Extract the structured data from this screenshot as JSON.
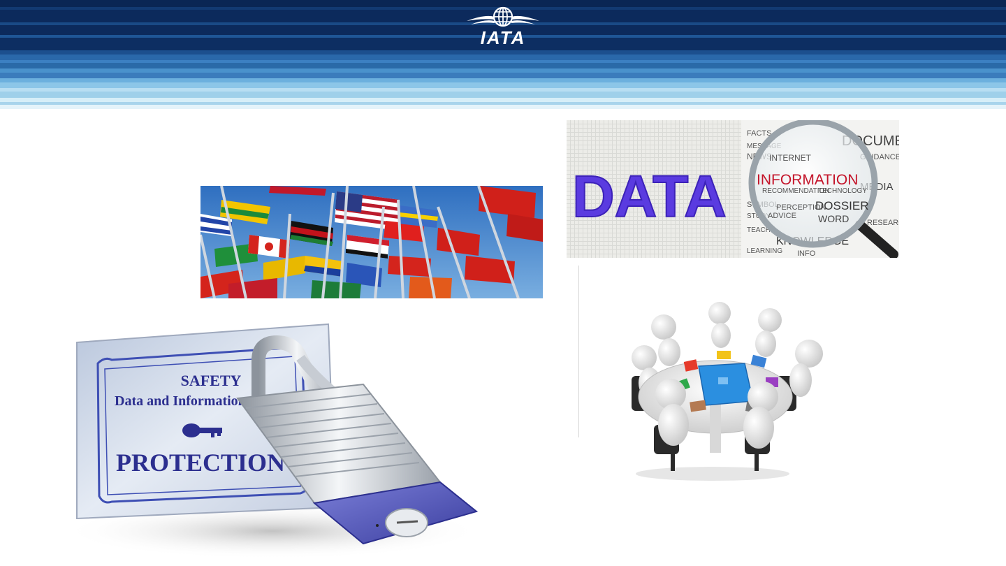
{
  "header": {
    "logo_text": "IATA",
    "colors": {
      "navy": "#0c2a5c",
      "mid_blue": "#2a6aa8",
      "light_blue": "#9fd0ea"
    }
  },
  "images": {
    "flags": {
      "icon": "world-flags-photo"
    },
    "data": {
      "icon": "data-word-cloud-magnifier",
      "title_word": "DATA",
      "magnified_word": "INFORMATION",
      "words": [
        "KNOWLEDGE",
        "DOSSIER",
        "WORD",
        "NEWS",
        "ADVICE",
        "LEARNING",
        "INFO",
        "DOCUMENT",
        "MEDIA",
        "GUIDANCE",
        "RESEARCH",
        "PERCEPTION",
        "TECHNOLOGY",
        "RECOMMENDATION",
        "MESSAGE",
        "FACTS",
        "INTERNET",
        "SYMBOL",
        "STUDY",
        "TEACH"
      ]
    },
    "lock": {
      "icon": "padlock-protection-sign",
      "line1": "SAFETY",
      "line2": "Data and Information",
      "line3": "PROTECTION"
    },
    "meeting": {
      "icon": "round-table-puzzle-meeting"
    }
  }
}
